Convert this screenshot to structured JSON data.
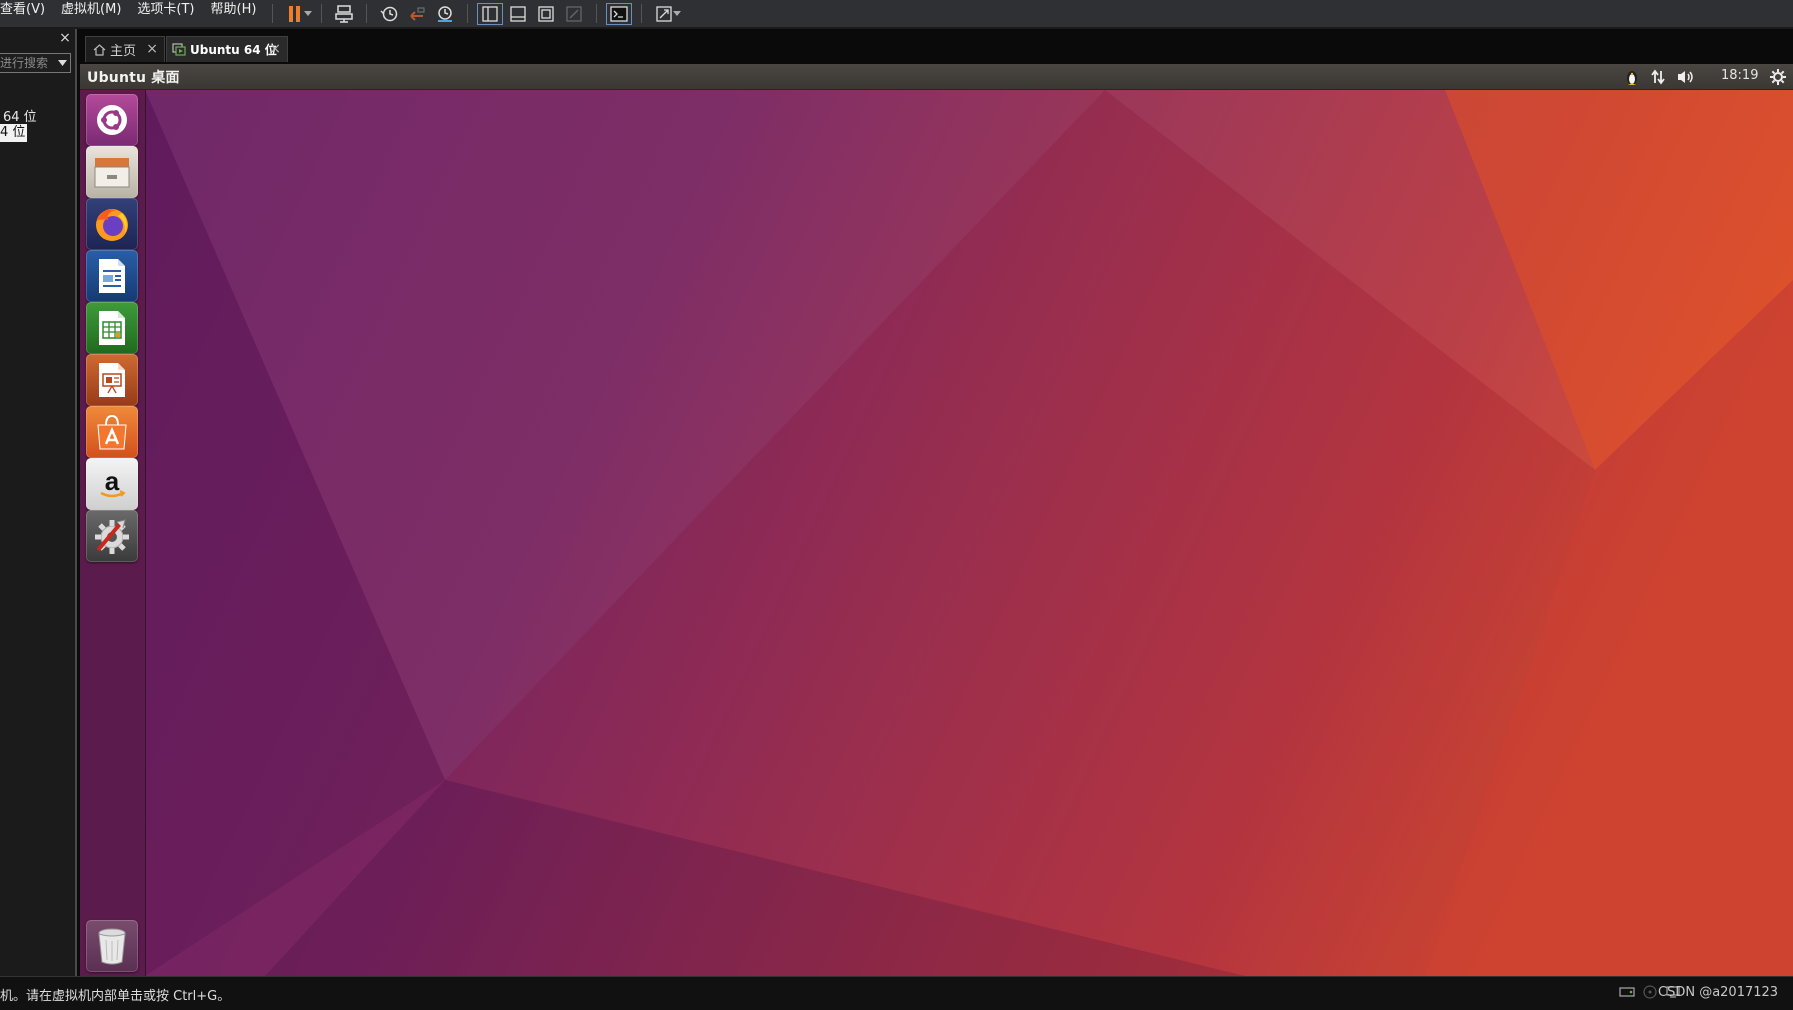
{
  "menubar": {
    "items": [
      "查看(V)",
      "虚拟机(M)",
      "选项卡(T)",
      "帮助(H)"
    ]
  },
  "colors": {
    "pause_accent": "#f07d28",
    "launcher_bg": "#5c1b4d",
    "wallpaper_left": "#6e1f5f",
    "wallpaper_right": "#d6492b"
  },
  "library": {
    "close": "×",
    "search_placeholder": "进行搜索",
    "items": [
      "64 位",
      "4 位"
    ]
  },
  "tabs": [
    {
      "label": "主页",
      "close": "×"
    },
    {
      "label": "Ubuntu 64 位",
      "close": "×"
    }
  ],
  "guest": {
    "topbar_title": "Ubuntu 桌面",
    "clock": "18:19",
    "launcher_icons": [
      "ubuntu-dash-icon",
      "files-icon",
      "firefox-icon",
      "writer-icon",
      "calc-icon",
      "impress-icon",
      "software-center-icon",
      "amazon-icon",
      "system-settings-icon",
      "trash-icon"
    ]
  },
  "statusbar": {
    "message": "机。请在虚拟机内部单击或按 Ctrl+G。",
    "watermark": "CSDN @a2017123"
  }
}
